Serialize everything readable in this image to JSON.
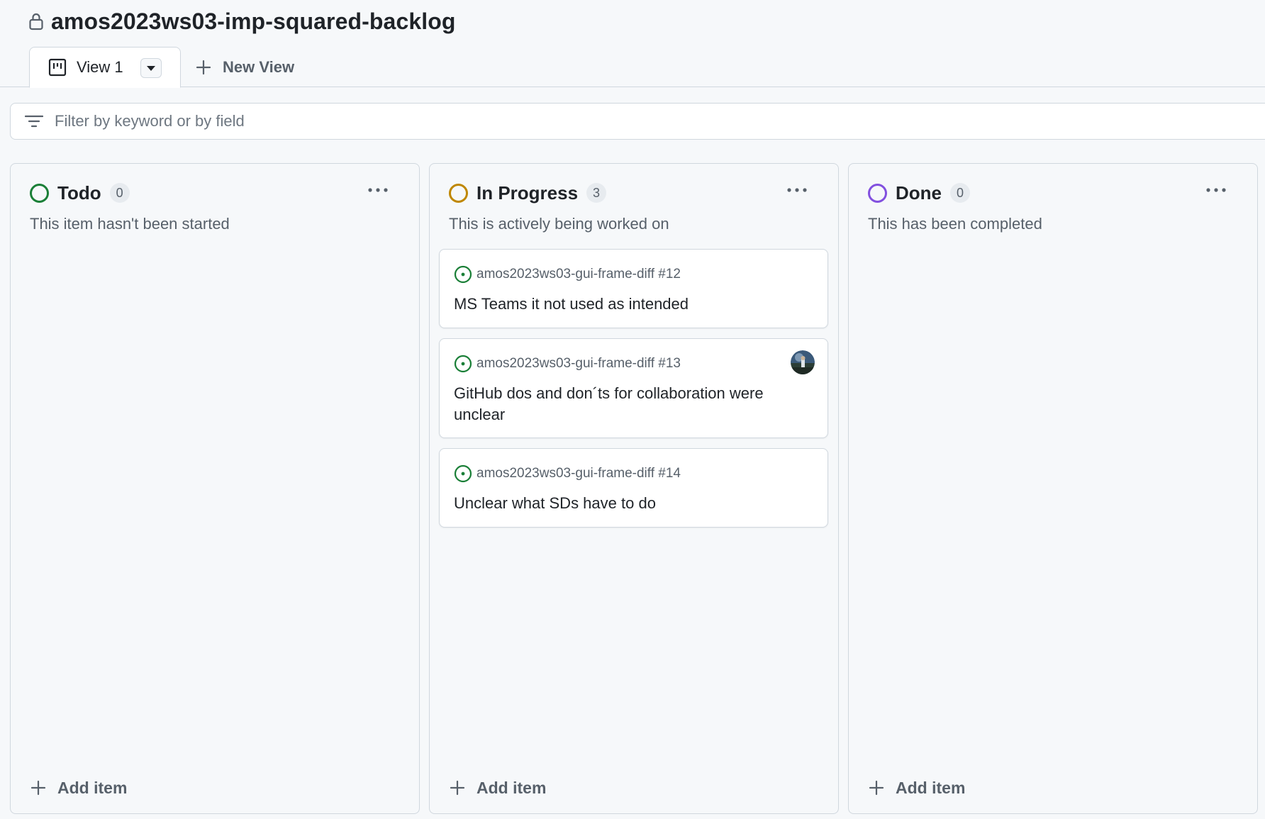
{
  "project": {
    "title": "amos2023ws03-imp-squared-backlog",
    "lock_icon": "lock-icon"
  },
  "tabs": {
    "active_label": "View 1",
    "active_icon": "board-icon",
    "new_view_label": "New View"
  },
  "filter": {
    "placeholder": "Filter by keyword or by field",
    "value": ""
  },
  "columns": [
    {
      "title": "Todo",
      "count": "0",
      "description": "This item hasn't been started",
      "status_color": "#1a7f37",
      "add_label": "Add item"
    },
    {
      "title": "In Progress",
      "count": "3",
      "description": "This is actively being worked on",
      "status_color": "#bf8700",
      "add_label": "Add item",
      "cards": [
        {
          "ref": "amos2023ws03-gui-frame-diff #12",
          "title": "MS Teams it not used as intended"
        },
        {
          "ref": "amos2023ws03-gui-frame-diff #13",
          "title": "GitHub dos and don´ts for collaboration were unclear",
          "has_avatar": true
        },
        {
          "ref": "amos2023ws03-gui-frame-diff #14",
          "title": "Unclear what SDs have to do"
        }
      ]
    },
    {
      "title": "Done",
      "count": "0",
      "description": "This has been completed",
      "status_color": "#8250df",
      "add_label": "Add item"
    }
  ],
  "colors": {
    "open_issue": "#1a7f37",
    "border": "#d0d7de",
    "background": "#f6f8fa"
  }
}
